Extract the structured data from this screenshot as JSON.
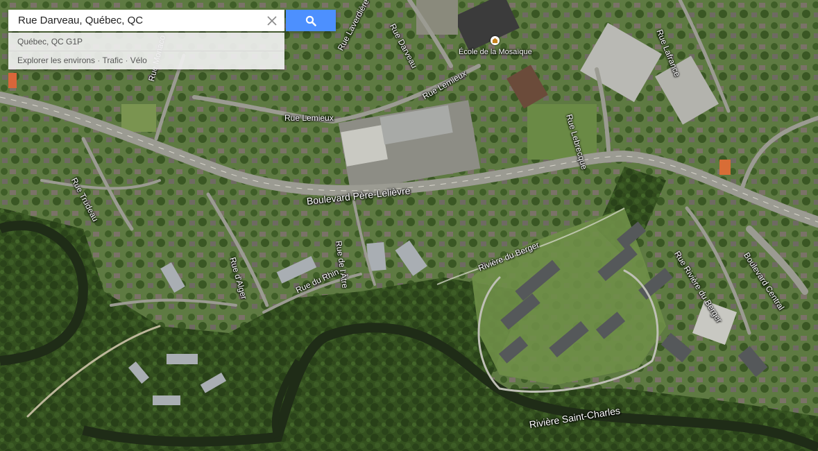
{
  "search": {
    "value": "Rue Darveau, Québec, QC",
    "placeholder": "",
    "clear_icon": "close-icon",
    "button_icon": "search-icon",
    "button_color": "#4d90fe"
  },
  "suggestion": {
    "address": "Québec, QC G1P",
    "explore": "Explorer les environs",
    "traffic": "Trafic",
    "bike": "Vélo",
    "separator": "·"
  },
  "poi": {
    "name": "École de la Mosaïque",
    "icon": "school-icon"
  },
  "streets": {
    "darveau": "Rue Darveau",
    "laverdiere": "Rue Laverdière",
    "monaco": "Rue Monaco",
    "lemieux_north": "Rue Lemieux",
    "lemieux_west": "Rue Lemieux",
    "lebrecque": "Rue Lebrecque",
    "lafrance": "Rue Lafrance",
    "trudeau": "Rue Trudeau",
    "pere_lelievre": "Boulevard Père-Lelièvre",
    "alger": "Rue d'Alger",
    "atre": "Rue de l'Âtre",
    "rhin": "Rue du Rhin",
    "riviere_berger_street": "Rue Rivière du Berger",
    "central": "Boulevard Central"
  },
  "water": {
    "berger": "Rivière du Berger",
    "saint_charles": "Rivière Saint-Charles"
  },
  "colors": {
    "road": "#9b9b92",
    "forest": "#2f4a1e",
    "river": "#22301a"
  }
}
